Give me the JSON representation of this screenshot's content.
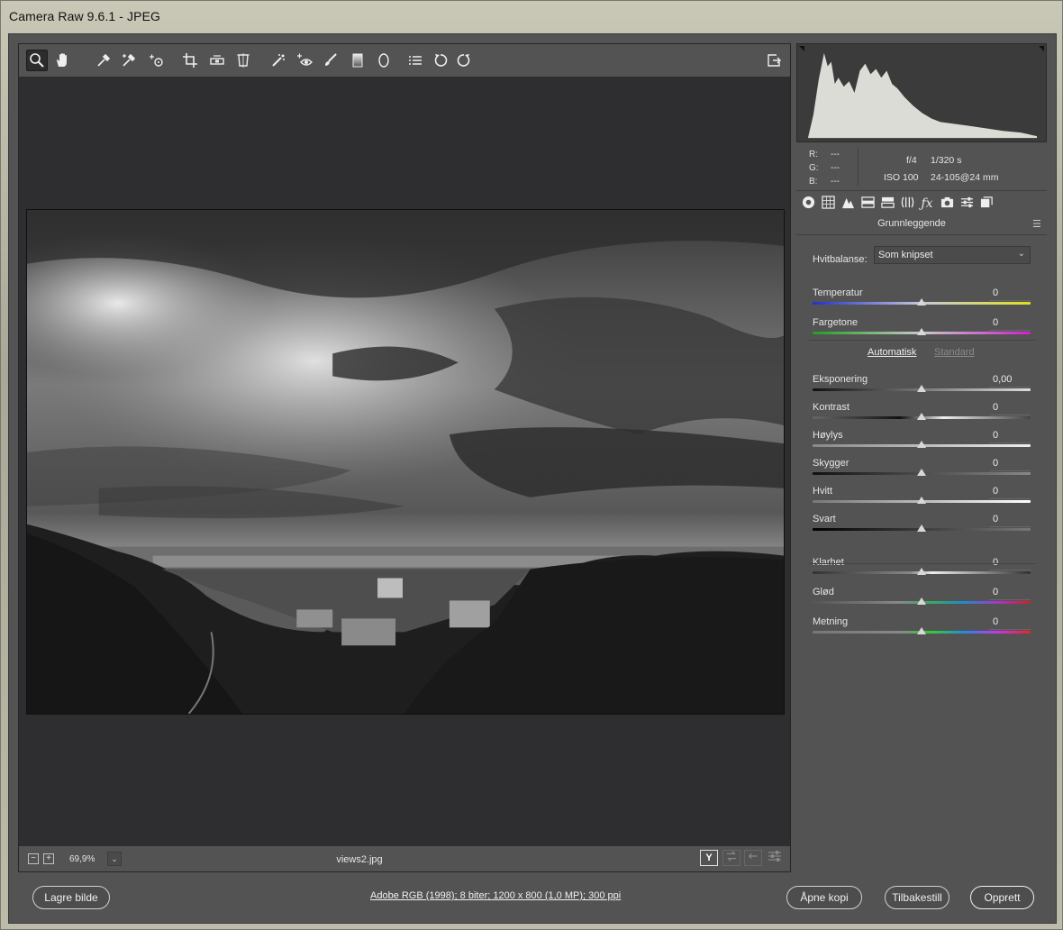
{
  "window": {
    "title": "Camera Raw 9.6.1  -  JPEG"
  },
  "toolbar": {
    "tools": [
      {
        "name": "zoom-tool",
        "icon": "magnifier-icon"
      },
      {
        "name": "hand-tool",
        "icon": "hand-icon"
      },
      {
        "name": "white-balance-tool",
        "icon": "eyedropper-icon"
      },
      {
        "name": "color-sampler-tool",
        "icon": "eyedropper-plus-icon"
      },
      {
        "name": "targeted-adjustment-tool",
        "icon": "target-icon"
      },
      {
        "name": "crop-tool",
        "icon": "crop-icon"
      },
      {
        "name": "straighten-tool",
        "icon": "level-icon"
      },
      {
        "name": "transform-tool",
        "icon": "transform-icon"
      },
      {
        "name": "spot-removal-tool",
        "icon": "spot-icon"
      },
      {
        "name": "red-eye-tool",
        "icon": "eye-icon"
      },
      {
        "name": "adjustment-brush-tool",
        "icon": "brush-icon"
      },
      {
        "name": "graduated-filter-tool",
        "icon": "gradient-icon"
      },
      {
        "name": "radial-filter-tool",
        "icon": "ellipse-icon"
      },
      {
        "name": "preferences-tool",
        "icon": "list-icon"
      },
      {
        "name": "rotate-left-tool",
        "icon": "rotate-ccw-icon"
      },
      {
        "name": "rotate-right-tool",
        "icon": "rotate-cw-icon"
      }
    ]
  },
  "preview": {
    "zoom_out": "−",
    "zoom_in": "+",
    "zoom_value": "69,9%",
    "zoom_dropdown": "⌄",
    "filename": "views2.jpg",
    "view_y": "Y"
  },
  "info": {
    "r_label": "R:",
    "r_value": "---",
    "g_label": "G:",
    "g_value": "---",
    "b_label": "B:",
    "b_value": "---",
    "aperture": "f/4",
    "shutter": "1/320 s",
    "iso": "ISO 100",
    "lens": "24-105@24 mm"
  },
  "panel": {
    "title": "Grunnleggende",
    "wb_label": "Hvitbalanse:",
    "wb_value": "Som knipset",
    "auto_label": "Automatisk",
    "standard_label": "Standard",
    "sliders": [
      {
        "label": "Temperatur",
        "value": "0",
        "position": 0.5
      },
      {
        "label": "Fargetone",
        "value": "0",
        "position": 0.5
      },
      {
        "label": "Eksponering",
        "value": "0,00",
        "position": 0.5
      },
      {
        "label": "Kontrast",
        "value": "0",
        "position": 0.5
      },
      {
        "label": "Høylys",
        "value": "0",
        "position": 0.5
      },
      {
        "label": "Skygger",
        "value": "0",
        "position": 0.5
      },
      {
        "label": "Hvitt",
        "value": "0",
        "position": 0.5
      },
      {
        "label": "Svart",
        "value": "0",
        "position": 0.5
      },
      {
        "label": "Klarhet",
        "value": "0",
        "position": 0.5
      },
      {
        "label": "Glød",
        "value": "0",
        "position": 0.5
      },
      {
        "label": "Metning",
        "value": "0",
        "position": 0.5
      }
    ]
  },
  "bottom": {
    "save_label": "Lagre bilde",
    "workflow_label": "Adobe RGB (1998); 8 biter; 1200 x 800 (1,0 MP); 300 ppi",
    "open_copy_label": "Åpne kopi",
    "reset_label": "Tilbakestill",
    "done_label": "Opprett"
  }
}
